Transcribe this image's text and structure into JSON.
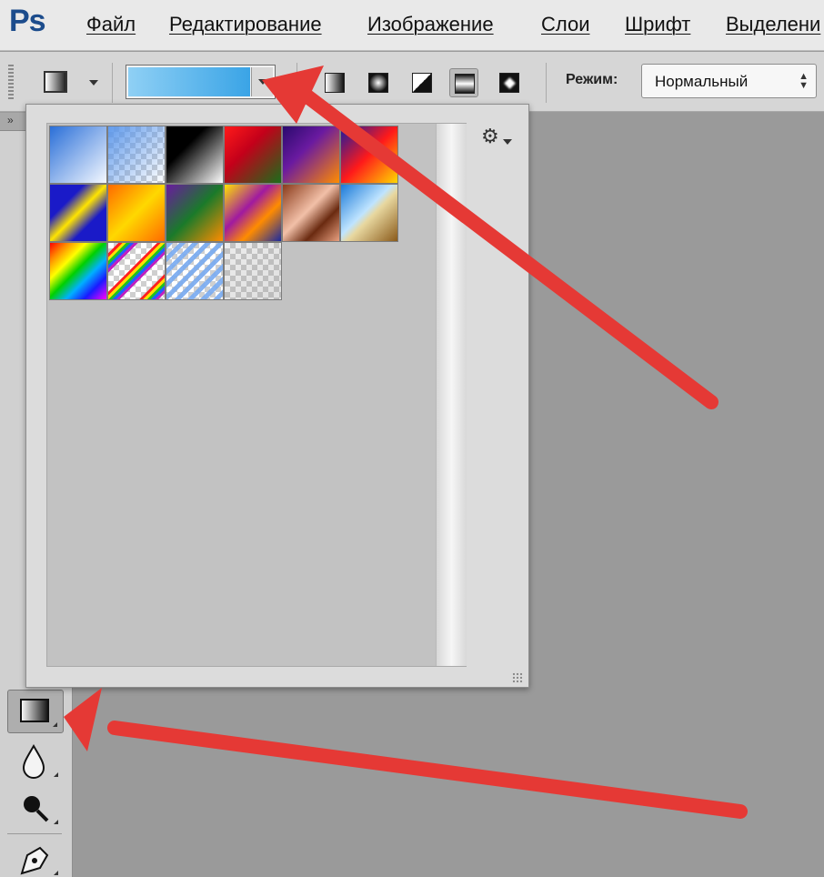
{
  "app": {
    "logo": "Ps"
  },
  "menu": [
    {
      "label": "Файл"
    },
    {
      "label": "Редактирование"
    },
    {
      "label": "Изображение"
    },
    {
      "label": "Слои"
    },
    {
      "label": "Шрифт"
    },
    {
      "label": "Выделени"
    }
  ],
  "options": {
    "mode_label": "Режим:",
    "mode_value": "Нормальный",
    "gradient_types": [
      "linear",
      "radial",
      "angle",
      "reflected",
      "diamond"
    ],
    "selected_gradient_type": "reflected",
    "current_gradient_colors": [
      "#8fd0f5",
      "#3aa4e6"
    ]
  },
  "tools_panel": {
    "header": "»",
    "tools": [
      "gradient-tool",
      "blur-tool",
      "dodge-tool",
      "pen-tool"
    ],
    "selected_tool": "gradient-tool"
  },
  "gradient_picker": {
    "menu_icon": "gear-icon",
    "presets": [
      {
        "name": "foreground-to-background",
        "css": "linear-gradient(135deg, #2a6fd8 0%, #f4f8ff 100%)"
      },
      {
        "name": "foreground-to-transparent",
        "css": "linear-gradient(135deg, rgba(90,150,235,0.95) 0%, rgba(90,150,235,0) 100%)",
        "transparent": true
      },
      {
        "name": "black-white",
        "css": "linear-gradient(135deg, #000 0%, #000 35%, #fff 100%)"
      },
      {
        "name": "red-green",
        "css": "linear-gradient(135deg, #ff1a1a 0%, #c4001a 40%, #1a6e1a 100%)"
      },
      {
        "name": "violet-orange",
        "css": "linear-gradient(135deg, #2a0a6e 0%, #6a1aa0 40%, #ff8c00 100%)"
      },
      {
        "name": "blue-red-yellow",
        "css": "linear-gradient(135deg, #1a1aa0 0%, #ff1a1a 50%, #ffd800 100%)"
      },
      {
        "name": "blue-yellow-blue",
        "css": "linear-gradient(135deg, #1a1ac8 0%, #1a1ac8 30%, #ffe400 50%, #1a1ac8 70%, #1a1ac8 100%)"
      },
      {
        "name": "orange-yellow-orange",
        "css": "linear-gradient(135deg, #ff6a00 0%, #ffd800 50%, #ff6a00 100%)"
      },
      {
        "name": "violet-green-orange",
        "css": "linear-gradient(135deg, #6a1aa0 0%, #1a7a2a 50%, #ff8c00 100%)"
      },
      {
        "name": "yellow-violet-orange-blue",
        "css": "linear-gradient(135deg, #ffe400 0%, #a01aa0 40%, #ff8c00 65%, #1a2aa0 100%)"
      },
      {
        "name": "copper",
        "css": "linear-gradient(135deg, #8a3a1a 0%, #f2c0a8 45%, #6a2a10 70%, #e8a080 100%)"
      },
      {
        "name": "chrome",
        "css": "linear-gradient(135deg, #1a7ad8 0%, #bfe4ff 45%, #e8d8a0 55%, #8a5a1a 100%)"
      },
      {
        "name": "spectrum",
        "css": "linear-gradient(135deg, #ff0000 0%, #ff8c00 16%, #ffff00 32%, #00d000 48%, #00b0ff 64%, #1a1aff 80%, #ff00ff 100%)"
      },
      {
        "name": "transparent-rainbow",
        "css": "repeating-linear-gradient(135deg, transparent 0 8px, #ff2020 8px 11px, #ffe000 11px 14px, #20c020 14px 17px, #2060ff 17px 20px, #c020c0 20px 23px, transparent 23px 30px)",
        "transparent": true
      },
      {
        "name": "transparent-stripes",
        "css": "repeating-linear-gradient(135deg, rgba(120,170,240,0.9) 0 5px, rgba(255,255,255,0) 5px 10px)",
        "transparent": true
      },
      {
        "name": "neutral-density",
        "css": "linear-gradient(135deg, rgba(128,128,128,0.15), rgba(128,128,128,0.25))",
        "transparent": true
      }
    ]
  }
}
